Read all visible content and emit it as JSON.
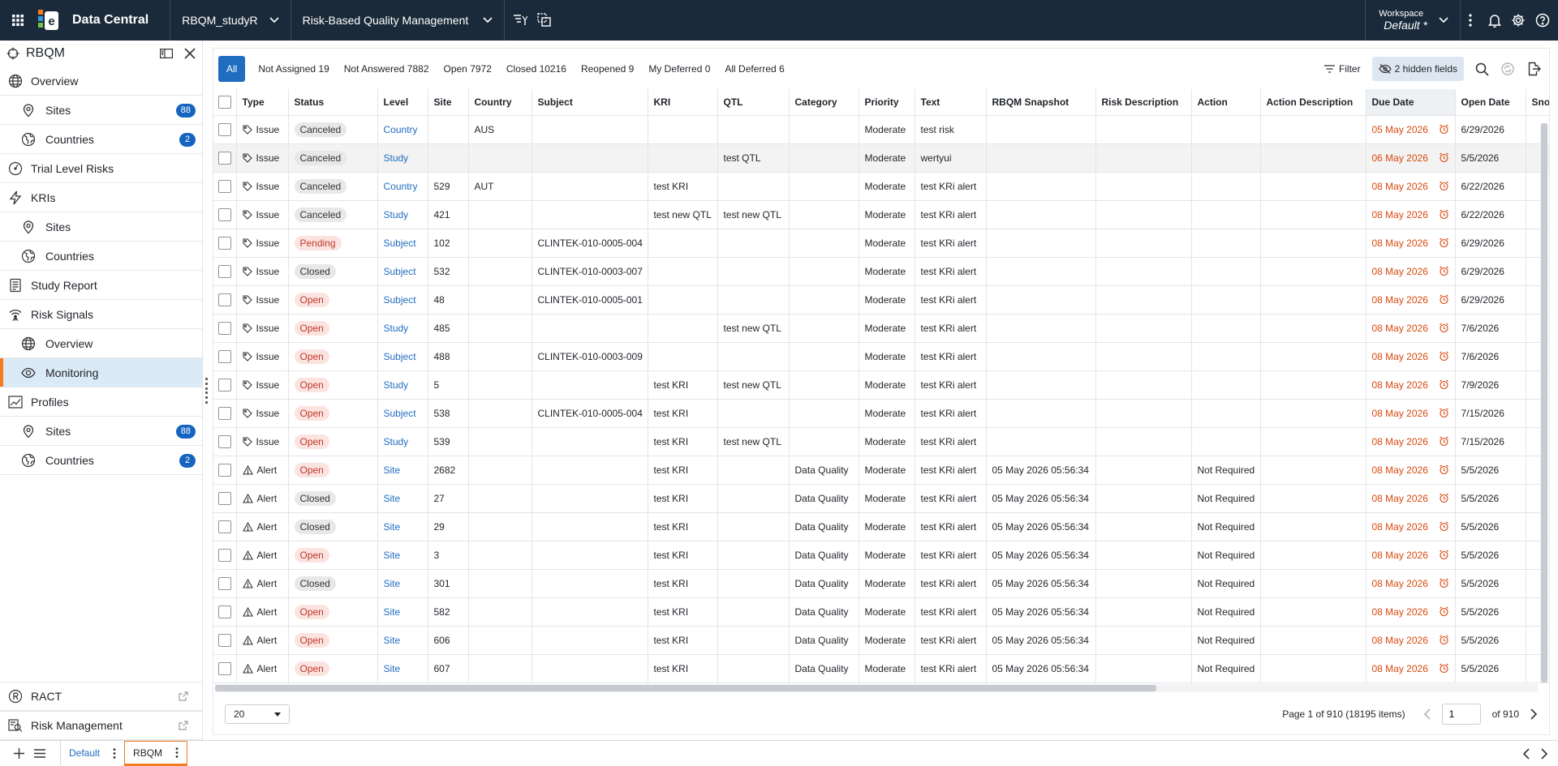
{
  "topbar": {
    "app_name": "Data Central",
    "study": "RBQM_studyR",
    "module": "Risk-Based Quality Management",
    "workspace_label": "Workspace",
    "workspace_value": "Default",
    "workspace_mark": "*"
  },
  "sidebar": {
    "title": "RBQM",
    "items": [
      {
        "label": "Overview",
        "level": 1,
        "icon": "globe-icon"
      },
      {
        "label": "Sites",
        "level": 2,
        "icon": "map-pin-icon",
        "badge": "88"
      },
      {
        "label": "Countries",
        "level": 2,
        "icon": "countries-icon",
        "badge": "2"
      },
      {
        "label": "Trial Level Risks",
        "level": 1,
        "icon": "gauge-icon"
      },
      {
        "label": "KRIs",
        "level": 1,
        "icon": "bolt-icon"
      },
      {
        "label": "Sites",
        "level": 2,
        "icon": "map-pin-icon"
      },
      {
        "label": "Countries",
        "level": 2,
        "icon": "countries-icon"
      },
      {
        "label": "Study Report",
        "level": 1,
        "icon": "report-icon"
      },
      {
        "label": "Risk Signals",
        "level": 1,
        "icon": "signal-icon"
      },
      {
        "label": "Overview",
        "level": 2,
        "icon": "globe-icon"
      },
      {
        "label": "Monitoring",
        "level": 2,
        "icon": "eye-icon",
        "active": true
      },
      {
        "label": "Profiles",
        "level": 1,
        "icon": "chart-line-icon"
      },
      {
        "label": "Sites",
        "level": 2,
        "icon": "map-pin-icon",
        "badge": "88"
      },
      {
        "label": "Countries",
        "level": 2,
        "icon": "countries-icon",
        "badge": "2"
      }
    ],
    "bottom_items": [
      {
        "label": "RACT",
        "icon": "ract-icon"
      },
      {
        "label": "Risk Management",
        "icon": "risk-search-icon"
      }
    ]
  },
  "toolbar": {
    "filters": [
      "All",
      "Not Assigned 19",
      "Not Answered 7882",
      "Open 7972",
      "Closed 10216",
      "Reopened 9",
      "My Deferred 0",
      "All Deferred 6"
    ],
    "filter_label": "Filter",
    "hidden_fields_label": "2 hidden fields"
  },
  "grid": {
    "columns": [
      "Type",
      "Status",
      "Level",
      "Site",
      "Country",
      "Subject",
      "KRI",
      "QTL",
      "Category",
      "Priority",
      "Text",
      "RBQM Snapshot",
      "Risk Description",
      "Action",
      "Action Description",
      "Due Date",
      "Open Date",
      "Snoo"
    ],
    "sorted_column": "Due Date",
    "rows": [
      {
        "type": "Issue",
        "status": "Canceled",
        "level": "Country",
        "site": "",
        "country": "AUS",
        "subject": "",
        "kri": "",
        "qtl": "",
        "category": "",
        "priority": "Moderate",
        "text": "test risk",
        "snapshot": "",
        "risk_desc": "",
        "action": "",
        "action_desc": "",
        "due": "05 May 2026",
        "open": "6/29/2026"
      },
      {
        "type": "Issue",
        "status": "Canceled",
        "level": "Study",
        "site": "",
        "country": "",
        "subject": "",
        "kri": "",
        "qtl": "test QTL",
        "category": "",
        "priority": "Moderate",
        "text": "wertyui",
        "snapshot": "",
        "risk_desc": "",
        "action": "",
        "action_desc": "",
        "due": "06 May 2026",
        "open": "5/5/2026"
      },
      {
        "type": "Issue",
        "status": "Canceled",
        "level": "Country",
        "site": "529",
        "country": "AUT",
        "subject": "",
        "kri": "test KRI",
        "qtl": "",
        "category": "",
        "priority": "Moderate",
        "text": "test KRi alert",
        "snapshot": "",
        "risk_desc": "",
        "action": "",
        "action_desc": "",
        "due": "08 May 2026",
        "open": "6/22/2026"
      },
      {
        "type": "Issue",
        "status": "Canceled",
        "level": "Study",
        "site": "421",
        "country": "",
        "subject": "",
        "kri": "test new QTL",
        "qtl": "test new QTL",
        "category": "",
        "priority": "Moderate",
        "text": "test KRi alert",
        "snapshot": "",
        "risk_desc": "",
        "action": "",
        "action_desc": "",
        "due": "08 May 2026",
        "open": "6/22/2026"
      },
      {
        "type": "Issue",
        "status": "Pending",
        "level": "Subject",
        "site": "102",
        "country": "",
        "subject": "CLINTEK-010-0005-004",
        "kri": "",
        "qtl": "",
        "category": "",
        "priority": "Moderate",
        "text": "test KRi alert",
        "snapshot": "",
        "risk_desc": "",
        "action": "",
        "action_desc": "",
        "due": "08 May 2026",
        "open": "6/29/2026"
      },
      {
        "type": "Issue",
        "status": "Closed",
        "level": "Subject",
        "site": "532",
        "country": "",
        "subject": "CLINTEK-010-0003-007",
        "kri": "",
        "qtl": "",
        "category": "",
        "priority": "Moderate",
        "text": "test KRi alert",
        "snapshot": "",
        "risk_desc": "",
        "action": "",
        "action_desc": "",
        "due": "08 May 2026",
        "open": "6/29/2026"
      },
      {
        "type": "Issue",
        "status": "Open",
        "level": "Subject",
        "site": "48",
        "country": "",
        "subject": "CLINTEK-010-0005-001",
        "kri": "",
        "qtl": "",
        "category": "",
        "priority": "Moderate",
        "text": "test KRi alert",
        "snapshot": "",
        "risk_desc": "",
        "action": "",
        "action_desc": "",
        "due": "08 May 2026",
        "open": "6/29/2026"
      },
      {
        "type": "Issue",
        "status": "Open",
        "level": "Study",
        "site": "485",
        "country": "",
        "subject": "",
        "kri": "",
        "qtl": "test new QTL",
        "category": "",
        "priority": "Moderate",
        "text": "test KRi alert",
        "snapshot": "",
        "risk_desc": "",
        "action": "",
        "action_desc": "",
        "due": "08 May 2026",
        "open": "7/6/2026"
      },
      {
        "type": "Issue",
        "status": "Open",
        "level": "Subject",
        "site": "488",
        "country": "",
        "subject": "CLINTEK-010-0003-009",
        "kri": "",
        "qtl": "",
        "category": "",
        "priority": "Moderate",
        "text": "test KRi alert",
        "snapshot": "",
        "risk_desc": "",
        "action": "",
        "action_desc": "",
        "due": "08 May 2026",
        "open": "7/6/2026"
      },
      {
        "type": "Issue",
        "status": "Open",
        "level": "Study",
        "site": "5",
        "country": "",
        "subject": "",
        "kri": "test KRI",
        "qtl": "test new QTL",
        "category": "",
        "priority": "Moderate",
        "text": "test KRi alert",
        "snapshot": "",
        "risk_desc": "",
        "action": "",
        "action_desc": "",
        "due": "08 May 2026",
        "open": "7/9/2026"
      },
      {
        "type": "Issue",
        "status": "Open",
        "level": "Subject",
        "site": "538",
        "country": "",
        "subject": "CLINTEK-010-0005-004",
        "kri": "test KRI",
        "qtl": "",
        "category": "",
        "priority": "Moderate",
        "text": "test KRi alert",
        "snapshot": "",
        "risk_desc": "",
        "action": "",
        "action_desc": "",
        "due": "08 May 2026",
        "open": "7/15/2026"
      },
      {
        "type": "Issue",
        "status": "Open",
        "level": "Study",
        "site": "539",
        "country": "",
        "subject": "",
        "kri": "test KRI",
        "qtl": "test new QTL",
        "category": "",
        "priority": "Moderate",
        "text": "test KRi alert",
        "snapshot": "",
        "risk_desc": "",
        "action": "",
        "action_desc": "",
        "due": "08 May 2026",
        "open": "7/15/2026"
      },
      {
        "type": "Alert",
        "status": "Open",
        "level": "Site",
        "site": "2682",
        "country": "",
        "subject": "",
        "kri": "test KRI",
        "qtl": "",
        "category": "Data Quality",
        "priority": "Moderate",
        "text": "test KRi alert",
        "snapshot": "05 May 2026 05:56:34",
        "risk_desc": "",
        "action": "Not Required",
        "action_desc": "",
        "due": "08 May 2026",
        "open": "5/5/2026"
      },
      {
        "type": "Alert",
        "status": "Closed",
        "level": "Site",
        "site": "27",
        "country": "",
        "subject": "",
        "kri": "test KRI",
        "qtl": "",
        "category": "Data Quality",
        "priority": "Moderate",
        "text": "test KRi alert",
        "snapshot": "05 May 2026 05:56:34",
        "risk_desc": "",
        "action": "Not Required",
        "action_desc": "",
        "due": "08 May 2026",
        "open": "5/5/2026"
      },
      {
        "type": "Alert",
        "status": "Closed",
        "level": "Site",
        "site": "29",
        "country": "",
        "subject": "",
        "kri": "test KRI",
        "qtl": "",
        "category": "Data Quality",
        "priority": "Moderate",
        "text": "test KRi alert",
        "snapshot": "05 May 2026 05:56:34",
        "risk_desc": "",
        "action": "Not Required",
        "action_desc": "",
        "due": "08 May 2026",
        "open": "5/5/2026"
      },
      {
        "type": "Alert",
        "status": "Open",
        "level": "Site",
        "site": "3",
        "country": "",
        "subject": "",
        "kri": "test KRI",
        "qtl": "",
        "category": "Data Quality",
        "priority": "Moderate",
        "text": "test KRi alert",
        "snapshot": "05 May 2026 05:56:34",
        "risk_desc": "",
        "action": "Not Required",
        "action_desc": "",
        "due": "08 May 2026",
        "open": "5/5/2026"
      },
      {
        "type": "Alert",
        "status": "Closed",
        "level": "Site",
        "site": "301",
        "country": "",
        "subject": "",
        "kri": "test KRI",
        "qtl": "",
        "category": "Data Quality",
        "priority": "Moderate",
        "text": "test KRi alert",
        "snapshot": "05 May 2026 05:56:34",
        "risk_desc": "",
        "action": "Not Required",
        "action_desc": "",
        "due": "08 May 2026",
        "open": "5/5/2026"
      },
      {
        "type": "Alert",
        "status": "Open",
        "level": "Site",
        "site": "582",
        "country": "",
        "subject": "",
        "kri": "test KRI",
        "qtl": "",
        "category": "Data Quality",
        "priority": "Moderate",
        "text": "test KRi alert",
        "snapshot": "05 May 2026 05:56:34",
        "risk_desc": "",
        "action": "Not Required",
        "action_desc": "",
        "due": "08 May 2026",
        "open": "5/5/2026"
      },
      {
        "type": "Alert",
        "status": "Open",
        "level": "Site",
        "site": "606",
        "country": "",
        "subject": "",
        "kri": "test KRI",
        "qtl": "",
        "category": "Data Quality",
        "priority": "Moderate",
        "text": "test KRi alert",
        "snapshot": "05 May 2026 05:56:34",
        "risk_desc": "",
        "action": "Not Required",
        "action_desc": "",
        "due": "08 May 2026",
        "open": "5/5/2026"
      },
      {
        "type": "Alert",
        "status": "Open",
        "level": "Site",
        "site": "607",
        "country": "",
        "subject": "",
        "kri": "test KRI",
        "qtl": "",
        "category": "Data Quality",
        "priority": "Moderate",
        "text": "test KRi alert",
        "snapshot": "05 May 2026 05:56:34",
        "risk_desc": "",
        "action": "Not Required",
        "action_desc": "",
        "due": "08 May 2026",
        "open": "5/5/2026"
      }
    ]
  },
  "pager": {
    "page_size": "20",
    "summary": "Page 1 of 910 (18195 items)",
    "current_page": "1",
    "of_total": "of 910"
  },
  "bottom_tabs": {
    "tabs": [
      {
        "label": "Default",
        "active": false
      },
      {
        "label": "RBQM",
        "active": true
      }
    ]
  },
  "colors": {
    "topbar_bg": "#1b2a3a",
    "accent": "#1f6cc0",
    "active_marker": "#f57c20",
    "due_date": "#d9480f"
  }
}
